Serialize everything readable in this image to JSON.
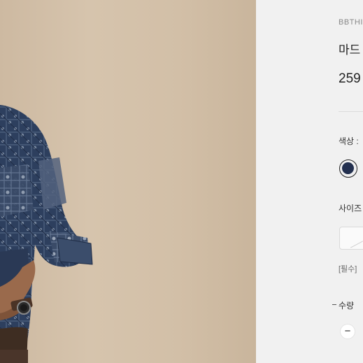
{
  "product": {
    "brand": "BBTHI",
    "title": "마드",
    "price": "259"
  },
  "options": {
    "color_label": "색상 :",
    "colors": [
      {
        "name": "navy",
        "hex": "#23304f",
        "selected": true
      }
    ],
    "size_label": "사이즈",
    "required_note": "[필수]"
  },
  "quantity": {
    "label": "수량",
    "minus_symbol": "−"
  },
  "photo": {
    "subject": "model-wearing-patchwork-shirt"
  }
}
